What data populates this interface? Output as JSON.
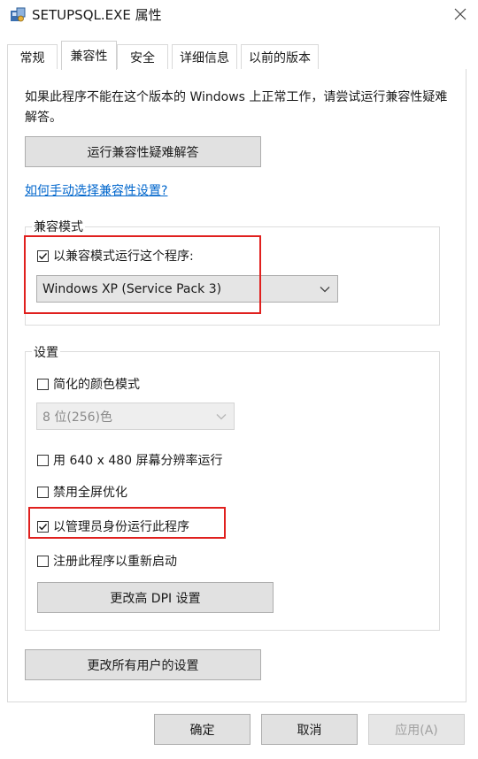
{
  "window": {
    "title": "SETUPSQL.EXE 属性"
  },
  "tabs": [
    {
      "label": "常规"
    },
    {
      "label": "兼容性"
    },
    {
      "label": "安全"
    },
    {
      "label": "详细信息"
    },
    {
      "label": "以前的版本"
    }
  ],
  "compat": {
    "intro": "如果此程序不能在这个版本的 Windows 上正常工作，请尝试运行兼容性疑难解答。",
    "troubleshoot_button": "运行兼容性疑难解答",
    "manual_link": "如何手动选择兼容性设置?",
    "mode_group": {
      "label": "兼容模式",
      "run_in_compat_mode": {
        "label": "以兼容模式运行这个程序:",
        "checked": true
      },
      "os_select": {
        "value": "Windows XP (Service Pack 3)"
      }
    },
    "settings_group": {
      "label": "设置",
      "reduced_color": {
        "label": "简化的颜色模式",
        "checked": false
      },
      "color_select": {
        "value": "8 位(256)色"
      },
      "resolution_640": {
        "label": "用 640 x 480 屏幕分辨率运行",
        "checked": false
      },
      "disable_fullscreen_opt": {
        "label": "禁用全屏优化",
        "checked": false
      },
      "run_as_admin": {
        "label": "以管理员身份运行此程序",
        "checked": true
      },
      "register_restart": {
        "label": "注册此程序以重新启动",
        "checked": false
      },
      "dpi_button": "更改高 DPI 设置"
    },
    "all_users_button": "更改所有用户的设置"
  },
  "footer": {
    "ok": "确定",
    "cancel": "取消",
    "apply": "应用(A)"
  },
  "colors": {
    "highlight": "#e0201e",
    "link": "#0066cc"
  }
}
